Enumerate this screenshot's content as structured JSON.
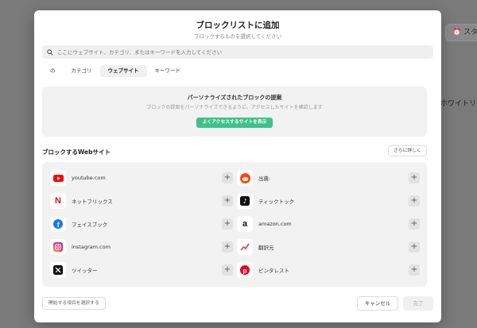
{
  "background": {
    "button_label": "スタ",
    "label": "ホワイトリスト"
  },
  "modal": {
    "title": "ブロックリストに追加",
    "subtitle": "ブロックするものを選択してください",
    "search_placeholder": "ここにウェブサイト、カテゴリ、またはキーワードを入力してください",
    "tabs": [
      {
        "label": "の",
        "active": false
      },
      {
        "label": "カテゴリ",
        "active": false
      },
      {
        "label": "ウェブサイト",
        "active": true
      },
      {
        "label": "キーワード",
        "active": false
      }
    ],
    "suggest": {
      "title": "パーソナライズされたブロックの提案",
      "desc": "ブロックの提案をパーソナライズできるように、アクセスしたサイトを確認します",
      "button": "よくアクセスするサイトを表示"
    },
    "section_title": "ブロックするWebサイト",
    "more_button": "さらに詳しく",
    "sites": [
      {
        "name": "youtube.com",
        "icon": "youtube-icon"
      },
      {
        "name": "出典:",
        "icon": "reddit-icon"
      },
      {
        "name": "ネットフリックス",
        "icon": "netflix-icon"
      },
      {
        "name": "ティックトック",
        "icon": "tiktok-icon"
      },
      {
        "name": "フェイスブック",
        "icon": "facebook-icon"
      },
      {
        "name": "amazon.com",
        "icon": "amazon-icon"
      },
      {
        "name": "instagram.com",
        "icon": "instagram-icon"
      },
      {
        "name": "翻訳元",
        "icon": "trend-icon"
      },
      {
        "name": "ツイッター",
        "icon": "x-icon"
      },
      {
        "name": "ピンタレスト",
        "icon": "pinterest-icon"
      }
    ],
    "footer_left": "開始する項目を選択する",
    "cancel": "キャンセル",
    "done": "完了",
    "colors": {
      "accent": "#3fc28a",
      "youtube": "#ff0000",
      "netflix": "#e50914",
      "facebook": "#1877f2",
      "reddit": "#ff4500",
      "pinterest": "#e60023"
    }
  }
}
